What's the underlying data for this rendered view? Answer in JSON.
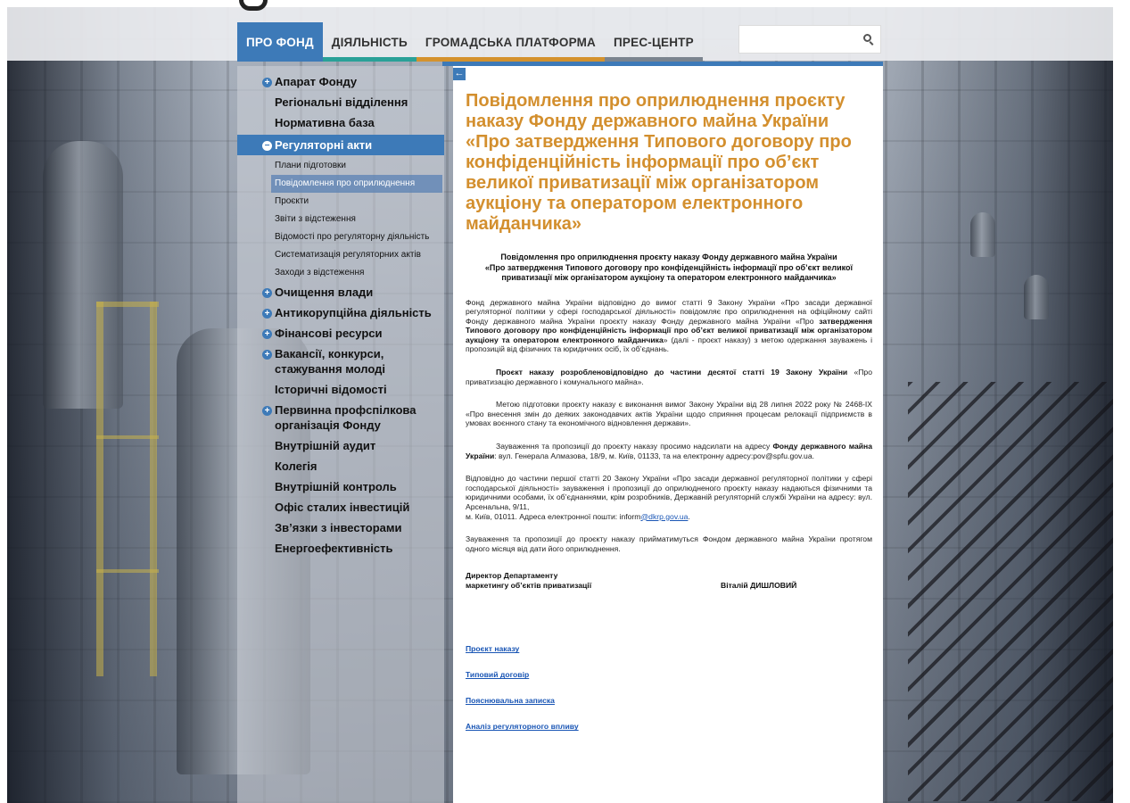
{
  "nav": {
    "items": [
      {
        "label": "ПРО ФОНД",
        "active": true,
        "stripe": "#3d7ab8"
      },
      {
        "label": "ДІЯЛЬНІСТЬ",
        "active": false,
        "stripe": "#2aa198"
      },
      {
        "label": "ГРОМАДСЬКА ПЛАТФОРМА",
        "active": false,
        "stripe": "#d4922e"
      },
      {
        "label": "ПРЕС-ЦЕНТР",
        "active": false,
        "stripe": "#7b848f"
      }
    ]
  },
  "search": {
    "placeholder": "",
    "icon": "search-icon"
  },
  "sidebar": {
    "items": [
      {
        "label": "Апарат Фонду",
        "icon": "plus-icon"
      },
      {
        "label": "Регіональні відділення"
      },
      {
        "label": "Нормативна база"
      },
      {
        "label": "Регуляторні акти",
        "icon": "minus-icon",
        "open": true,
        "children": [
          {
            "label": "Плани підготовки"
          },
          {
            "label": "Повідомлення про оприлюднення",
            "active": true
          },
          {
            "label": "Проєкти"
          },
          {
            "label": "Звіти з відстеження"
          },
          {
            "label": "Відомості про регуляторну діяльність"
          },
          {
            "label": "Систематизація регуляторних актів"
          },
          {
            "label": "Заходи з відстеження"
          }
        ]
      },
      {
        "label": "Очищення влади",
        "icon": "plus-icon"
      },
      {
        "label": "Антикорупційна діяльність",
        "icon": "plus-icon"
      },
      {
        "label": "Фінансові ресурси",
        "icon": "plus-icon"
      },
      {
        "label": "Вакансії, конкурси, стажування молоді",
        "icon": "plus-icon"
      },
      {
        "label": "Історичні відомості"
      },
      {
        "label": "Первинна профспілкова організація Фонду",
        "icon": "plus-icon"
      },
      {
        "label": "Внутрішній аудит"
      },
      {
        "label": "Колегія"
      },
      {
        "label": "Внутрішній контроль"
      },
      {
        "label": "Офіс сталих інвестицій"
      },
      {
        "label": "Зв’язки з інвесторами"
      },
      {
        "label": "Енергоефективність"
      }
    ]
  },
  "collapse_label": "←",
  "article": {
    "title": "Повідомлення про оприлюднення проєкту наказу Фонду державного майна України «Про затвердження Типового договору про конфіденційність інформації про об’єкт великої приватизації між організатором аукціону та оператором електронного майданчика»",
    "subheading_1": "Повідомлення про оприлюднення проєкту наказу Фонду державного майна України",
    "subheading_2": "«Про затвердження Типового договору про конфіденційність інформації про об’єкт великої приватизації між організатором аукціону та оператором електронного майданчика»",
    "p1_a": "Фонд державного майна України відповідно до вимог статті 9 Закону України «Про засади державної регуляторної політики у сфері господарської діяльності» повідомляє про оприлюднення на офіційному сайті Фонду державного майна України проєкту наказу Фонду державного майна України «Про ",
    "p1_b": "затвердження Типового договору про конфіденційність інформації про об’єкт великої приватизації між організатором аукціону та оператором електронного майданчика",
    "p1_c": "» (далі - проєкт наказу) з метою одержання зауважень і пропозицій від фізичних та юридичних осіб, їх об’єднань.",
    "p2_a": "Проєкт наказу розробленовідповідно до частини десятої статті 19 Закону України",
    "p2_b": " «Про приватизацію державного і комунального майна».",
    "p3": "Метою підготовки проєкту наказу є виконання вимог Закону України від 28 липня 2022 року № 2468-IX «Про внесення змін до деяких законодавчих актів України щодо сприяння процесам релокації підприємств в умовах воєнного стану та економічного відновлення держави».",
    "p4_a": "Зауваження та пропозиції до проєкту наказу просимо надсилати на адресу ",
    "p4_b": "Фонду державного майна України",
    "p4_c": ": вул. Генерала Алмазова, 18/9, м. Київ, 01133, та на електронну адресу:pov@spfu.gov.ua.",
    "p5_a": "Відповідно до частини першої статті 20 Закону України «Про засади державної регуляторної політики у сфері господарської діяльності» зауваження і пропозиції до оприлюдненого проєкту наказу надаються фізичними та юридичними особами, їх об’єднаннями, крім розробників, Державній регуляторній службі України на адресу: вул. Арсенальна, 9/11,",
    "p5_b": "м. Київ, 01011. Адреса електронної пошти: inform",
    "p5_link": "@dkrp.gov.ua",
    "p5_c": ".",
    "p6": "Зауваження та пропозиції до проєкту наказу прийматимуться  Фондом державного майна України протягом одного місяця від дати його оприлюднення.",
    "sign_line1": "Директор Департаменту",
    "sign_line2": "маркетингу об’єктів приватизації",
    "sign_name": "Віталій ДИШЛОВИЙ",
    "links": [
      "Проєкт наказу",
      "Типовий договір",
      "Пояснювальна записка",
      "Аналіз регуляторного впливу"
    ]
  }
}
